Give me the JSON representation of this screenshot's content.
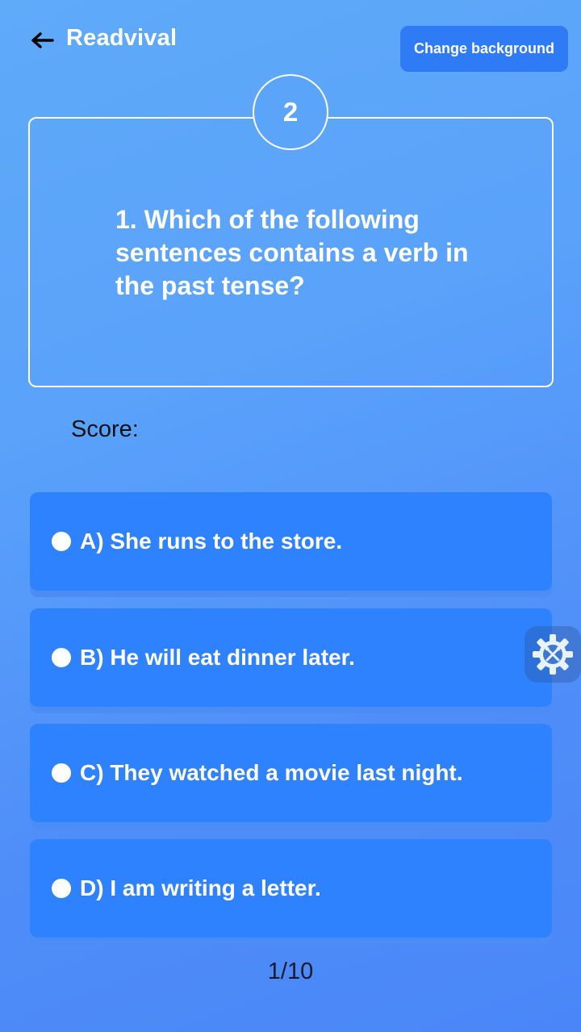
{
  "header": {
    "back_icon": "arrow-left-icon",
    "title": "Readvival",
    "change_background_label": "Change background"
  },
  "question": {
    "number": "2",
    "text": "1. Which of the following sentences contains a verb in the past tense?"
  },
  "score": {
    "label": "Score:"
  },
  "options": [
    {
      "label": "A) She runs to the store."
    },
    {
      "label": "B) He will eat dinner later."
    },
    {
      "label": "C) They watched a movie last night."
    },
    {
      "label": "D) I am writing a letter."
    }
  ],
  "progress": {
    "text": "1/10"
  },
  "floating_tools": {
    "icon": "tools-gear-icon"
  },
  "colors": {
    "background_top": "#5faaf9",
    "background_bottom": "#4a86f7",
    "button": "#2f7af5",
    "option": "#2f82fd",
    "text_dark": "#111111"
  }
}
